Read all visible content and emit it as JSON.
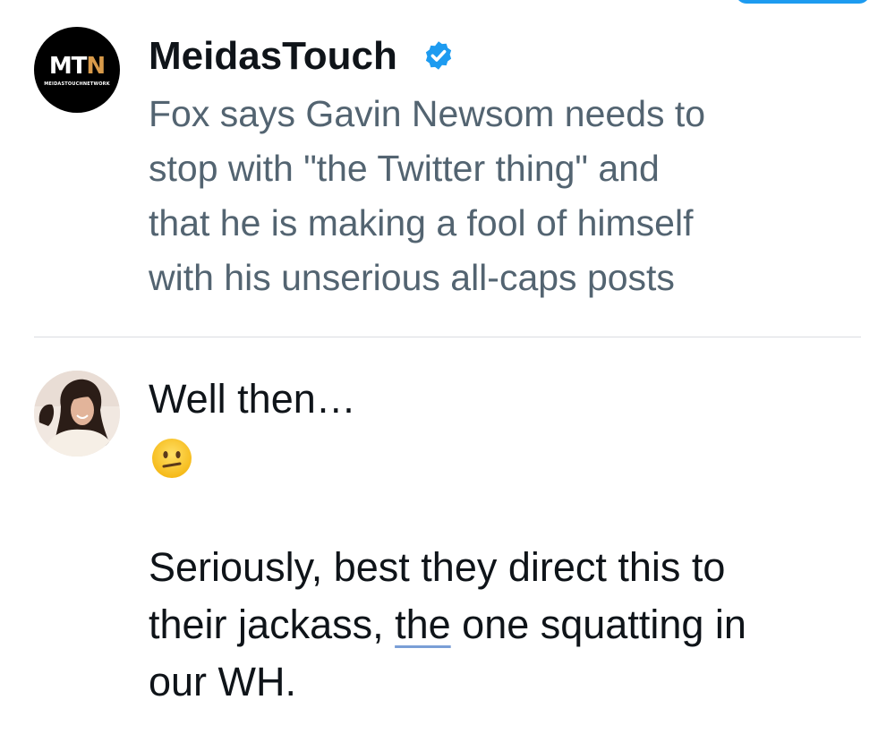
{
  "quoted_post": {
    "author": "MeidasTouch",
    "verified": true,
    "avatar_logo": {
      "letters": "MT",
      "accent_letter": "N",
      "subtext": "MEIDASTOUCHNETWORK"
    },
    "text": "Fox says Gavin Newsom needs to\nstop with \"the Twitter thing\" and\nthat he is making a fool of himself\nwith his unserious all-caps posts"
  },
  "reply_draft": {
    "line1": "Well then…",
    "emoji": "neutral-face",
    "text_before": "Seriously, best they direct this to\ntheir jackass, ",
    "spellcheck_word": "the",
    "text_after": " one squatting in\nour WH."
  },
  "colors": {
    "accent_blue": "#1d9bf0",
    "secondary_text": "#536471",
    "primary_text": "#0f1419",
    "divider": "#dadde1",
    "spellcheck_underline": "#7a9fd6"
  }
}
